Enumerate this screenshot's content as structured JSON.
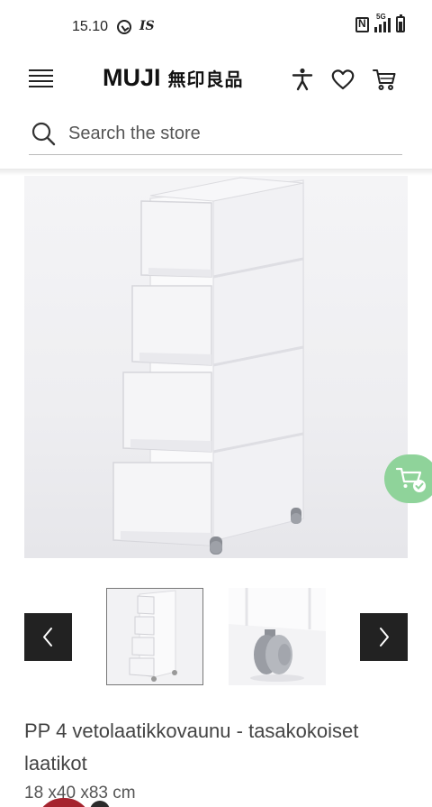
{
  "status_bar": {
    "time": "15.10",
    "carrier_badge": "IS",
    "network": "5G"
  },
  "header": {
    "logo_latin": "MUJI",
    "logo_japanese": "無印良品"
  },
  "search": {
    "placeholder": "Search the store"
  },
  "product": {
    "title": "PP 4 vetolaatikkovaunu - tasakokoiset laatikot",
    "dimensions": "18 x40 x83 cm"
  },
  "gallery": {
    "thumbnail_count": 2,
    "selected_index": 0
  },
  "colors": {
    "accent_green": "#8fd39a",
    "dark_button": "#222222",
    "badge_red": "#a5232e"
  },
  "icons": [
    "menu-icon",
    "accessibility-icon",
    "heart-icon",
    "cart-icon",
    "search-icon",
    "cart-check-icon",
    "chevron-left-icon",
    "chevron-right-icon"
  ]
}
